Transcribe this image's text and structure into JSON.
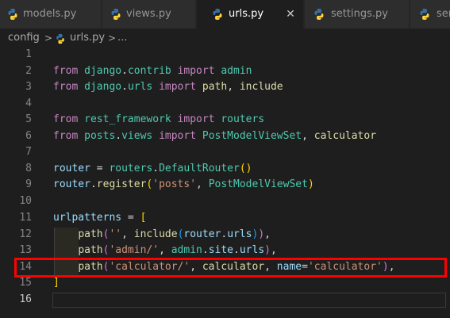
{
  "tabs": [
    {
      "label": "models.py",
      "active": false
    },
    {
      "label": "views.py",
      "active": false
    },
    {
      "label": "urls.py",
      "active": true
    },
    {
      "label": "settings.py",
      "active": false
    },
    {
      "label": "ser",
      "active": false
    }
  ],
  "close_glyph": "✕",
  "breadcrumb": {
    "folder": "config",
    "file": "urls.py",
    "symbol": "...",
    "separator": ">"
  },
  "editor": {
    "line_numbers": [
      "1",
      "2",
      "3",
      "4",
      "5",
      "6",
      "7",
      "8",
      "9",
      "10",
      "11",
      "12",
      "13",
      "14",
      "15",
      "16"
    ],
    "current_line": "16",
    "highlighted_line": "14"
  },
  "code": {
    "l2": [
      "from",
      " ",
      "django",
      ".",
      "contrib",
      " ",
      "import",
      " ",
      "admin"
    ],
    "l3": [
      "from",
      " ",
      "django",
      ".",
      "urls",
      " ",
      "import",
      " ",
      "path",
      ", ",
      "include"
    ],
    "l5": [
      "from",
      " ",
      "rest_framework",
      " ",
      "import",
      " ",
      "routers"
    ],
    "l6": [
      "from",
      " ",
      "posts",
      ".",
      "views",
      " ",
      "import",
      " ",
      "PostModelViewSet",
      ", ",
      "calculator"
    ],
    "l8": [
      "router",
      " = ",
      "routers",
      ".",
      "DefaultRouter",
      "(",
      ")"
    ],
    "l9": [
      "router",
      ".",
      "register",
      "(",
      "'posts'",
      ", ",
      "PostModelViewSet",
      ")"
    ],
    "l11": [
      "urlpatterns",
      " = ",
      "["
    ],
    "l12": [
      "    ",
      "path",
      "(",
      "''",
      ", ",
      "include",
      "(",
      "router",
      ".",
      "urls",
      ")",
      ")",
      ","
    ],
    "l13": [
      "    ",
      "path",
      "(",
      "'admin/'",
      ", ",
      "admin",
      ".",
      "site",
      ".",
      "urls",
      ")",
      ","
    ],
    "l14": [
      "    ",
      "path",
      "(",
      "'calculator/'",
      ", ",
      "calculator",
      ", ",
      "name",
      "=",
      "'calculator'",
      ")",
      ","
    ],
    "l15": [
      "]"
    ]
  },
  "colors": {
    "keyword": "#c586c0",
    "variable": "#9cdcfe",
    "class": "#4ec9b0",
    "function": "#dcdcaa",
    "string": "#ce9178",
    "highlight_box": "#ff0000",
    "python_icon_blue": "#3572a5",
    "python_icon_yellow": "#ffd43b"
  }
}
